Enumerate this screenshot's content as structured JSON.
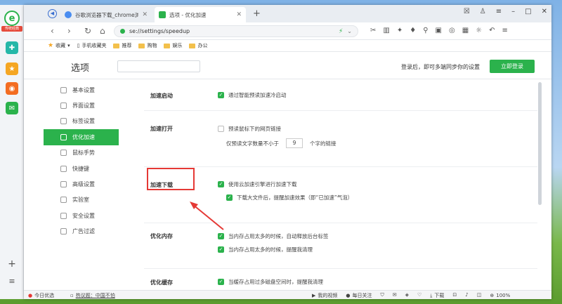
{
  "rail": {
    "logo_tag": "传统经典",
    "logo": "e"
  },
  "tabs": [
    {
      "label": "谷歌浏览器下载_chrome浏览器官"
    },
    {
      "label": "选项 - 优化加速"
    }
  ],
  "newtab": "+",
  "window_controls": {
    "min": "–",
    "max": "□",
    "close": "✕"
  },
  "address": {
    "url": "se://settings/speedup"
  },
  "bookmarks": [
    {
      "label": "收藏"
    },
    {
      "label": "手机收藏夹"
    },
    {
      "label": "推荐"
    },
    {
      "label": "购物"
    },
    {
      "label": "娱乐"
    },
    {
      "label": "办公"
    }
  ],
  "settings": {
    "title": "选项",
    "login_tip": "登录后，即可多端同步你的设置",
    "login_button": "立即登录"
  },
  "sidebar": {
    "items": [
      {
        "label": "基本设置"
      },
      {
        "label": "界面设置"
      },
      {
        "label": "标签设置"
      },
      {
        "label": "优化加速"
      },
      {
        "label": "鼠标手势"
      },
      {
        "label": "快捷键"
      },
      {
        "label": "高级设置"
      },
      {
        "label": "实验室"
      },
      {
        "label": "安全设置"
      },
      {
        "label": "广告过滤"
      }
    ]
  },
  "sections": {
    "startup": {
      "label": "加速启动",
      "opt1": "通过智能预读加速冷启动"
    },
    "open": {
      "label": "加速打开",
      "opt1": "预读鼠标下的网页链接",
      "opt2_prefix": "仅预读文字数量不小于",
      "opt2_value": "9",
      "opt2_suffix": "个字的链接"
    },
    "download": {
      "label": "加速下载",
      "opt1": "使用云加速引擎进行加速下载",
      "opt2": "下载大文件后，提醒加速效果（即“已加速”气泡）"
    },
    "memory": {
      "label": "优化内存",
      "opt1": "当内存占用太多的时候，自动释放后台标签",
      "opt2": "当内存占用太多的时候，提醒我清理"
    },
    "cache": {
      "label": "优化缓存",
      "opt1": "当缓存占用过多磁盘空间时，提醒我清理"
    }
  },
  "status": {
    "left1": "今日优选",
    "left2": "热议题：中国不怕",
    "video": "我的视频",
    "follow": "每日关注",
    "download": "下载",
    "zoom": "100%"
  },
  "colors": {
    "accent": "#2bb24c",
    "highlight": "#e53935"
  }
}
